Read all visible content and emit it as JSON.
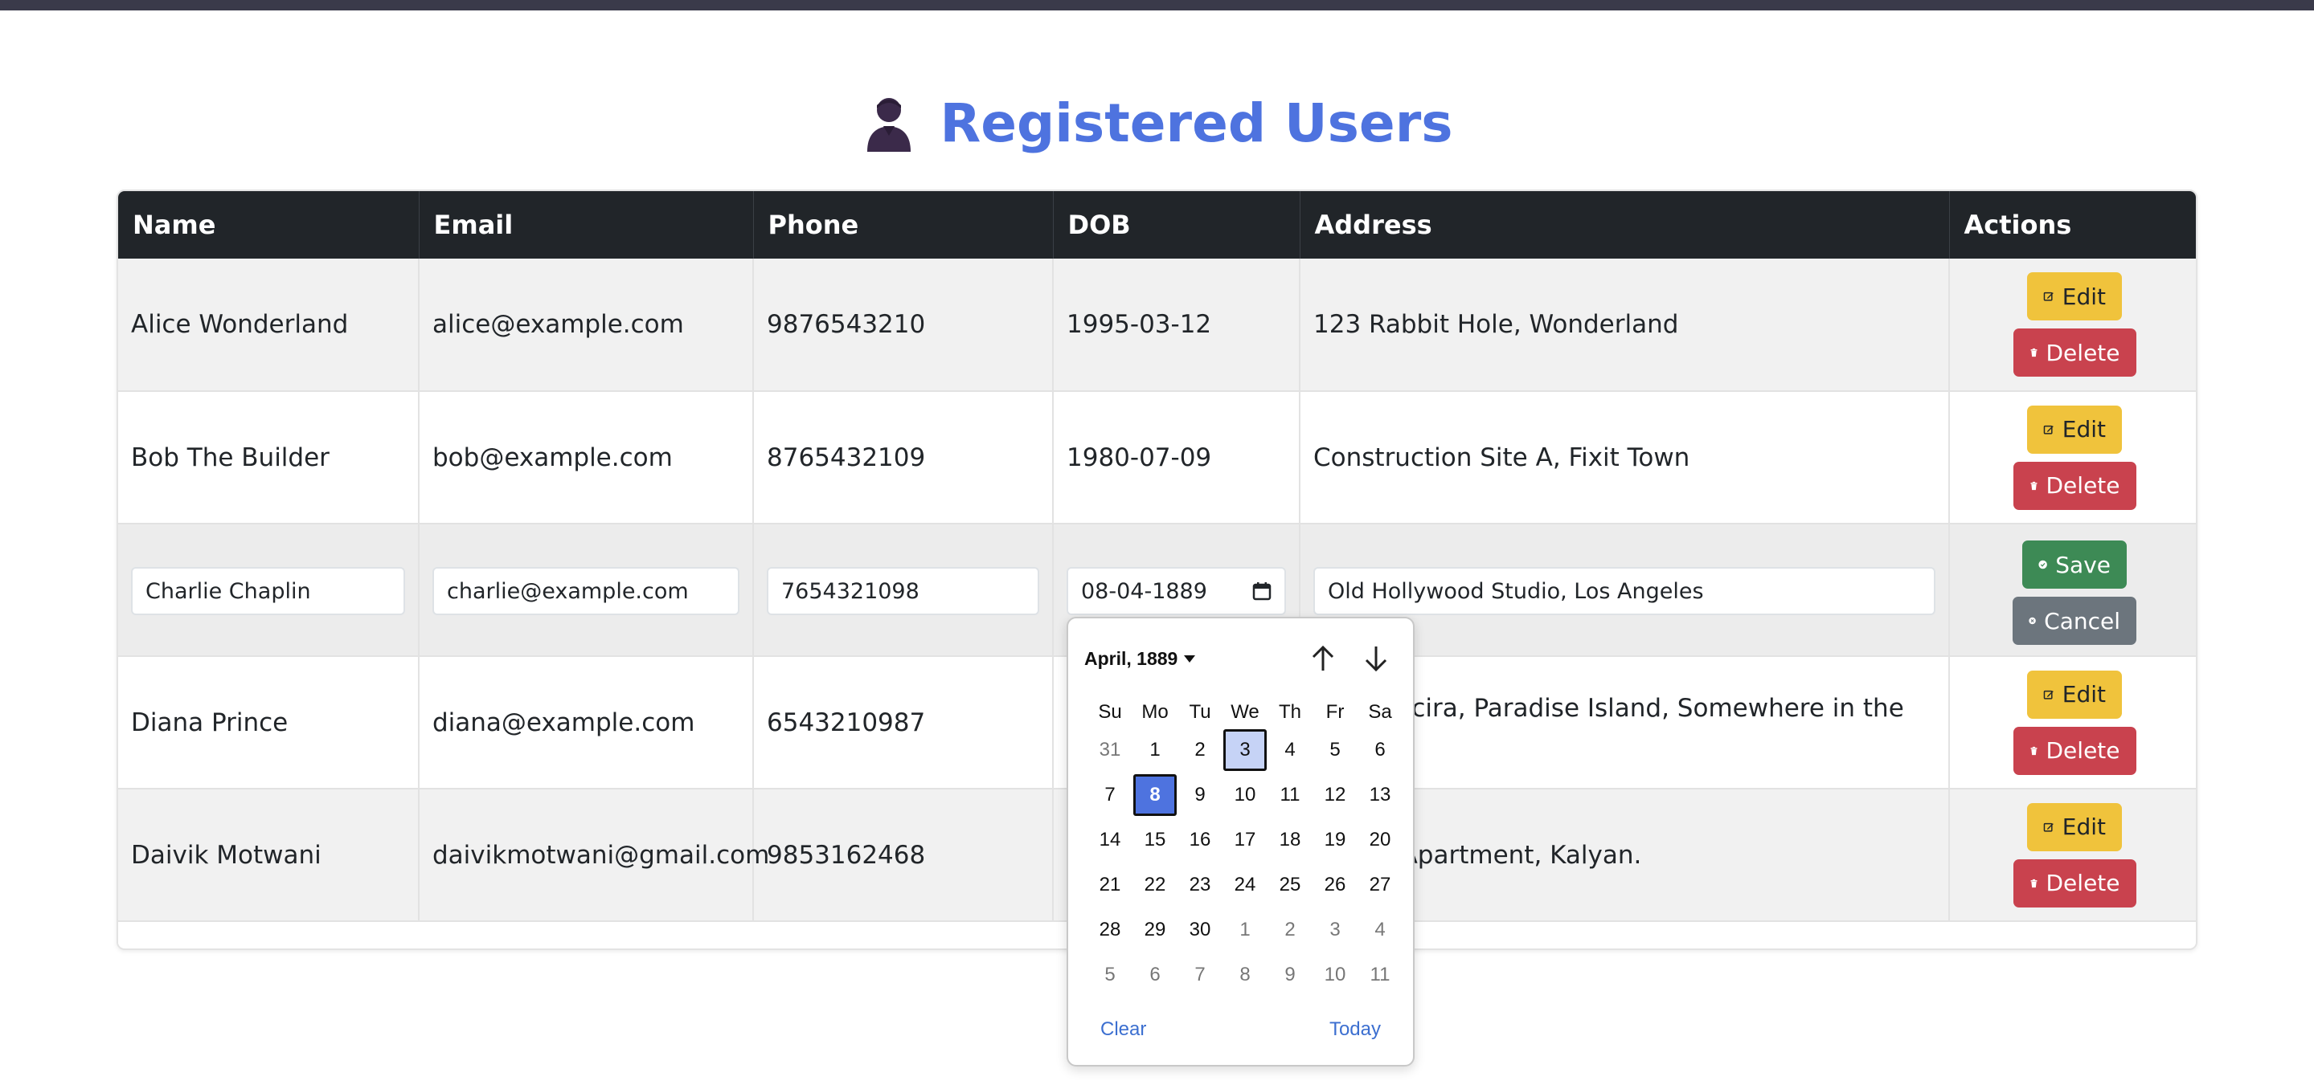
{
  "page": {
    "title": "Registered Users",
    "title_icon": "user-silhouette-icon"
  },
  "table": {
    "headers": [
      "Name",
      "Email",
      "Phone",
      "DOB",
      "Address",
      "Actions"
    ],
    "rows": [
      {
        "name": "Alice Wonderland",
        "email": "alice@example.com",
        "phone": "9876543210",
        "dob": "1995-03-12",
        "address": "123 Rabbit Hole, Wonderland"
      },
      {
        "name": "Bob The Builder",
        "email": "bob@example.com",
        "phone": "8765432109",
        "dob": "1980-07-09",
        "address": "Construction Site A, Fixit Town"
      },
      {
        "name": "Charlie Chaplin",
        "email": "charlie@example.com",
        "phone": "7654321098",
        "dob": "08-04-1889",
        "address": "Old Hollywood Studio, Los Angeles"
      },
      {
        "name": "Diana Prince",
        "email": "diana@example.com",
        "phone": "6543210987",
        "dob": "",
        "address": "Themyscira, Paradise Island, Somewhere in the Aegean"
      },
      {
        "name": "Daivik Motwani",
        "email": "daivikmotwani@gmail.com",
        "phone": "9853162468",
        "dob": "",
        "address": "Shanti Apartment, Kalyan."
      }
    ],
    "editing_row_index": 2
  },
  "actions": {
    "edit_label": "Edit",
    "delete_label": "Delete",
    "save_label": "Save",
    "cancel_label": "Cancel"
  },
  "datepicker": {
    "month_label": "April, 1889",
    "weekdays": [
      "Su",
      "Mo",
      "Tu",
      "We",
      "Th",
      "Fr",
      "Sa"
    ],
    "weeks": [
      [
        "31",
        "1",
        "2",
        "3",
        "4",
        "5",
        "6"
      ],
      [
        "7",
        "8",
        "9",
        "10",
        "11",
        "12",
        "13"
      ],
      [
        "14",
        "15",
        "16",
        "17",
        "18",
        "19",
        "20"
      ],
      [
        "21",
        "22",
        "23",
        "24",
        "25",
        "26",
        "27"
      ],
      [
        "28",
        "29",
        "30",
        "1",
        "2",
        "3",
        "4"
      ],
      [
        "5",
        "6",
        "7",
        "8",
        "9",
        "10",
        "11"
      ]
    ],
    "selected_day": "8",
    "hovered_day": "3",
    "clear_label": "Clear",
    "today_label": "Today"
  },
  "colors": {
    "title": "#4e73df",
    "header_bg": "#212529",
    "edit_btn": "#f0c33c",
    "delete_btn": "#c9424e",
    "save_btn": "#3d8a55",
    "cancel_btn": "#6c757d",
    "selected_day": "#4e73df"
  }
}
